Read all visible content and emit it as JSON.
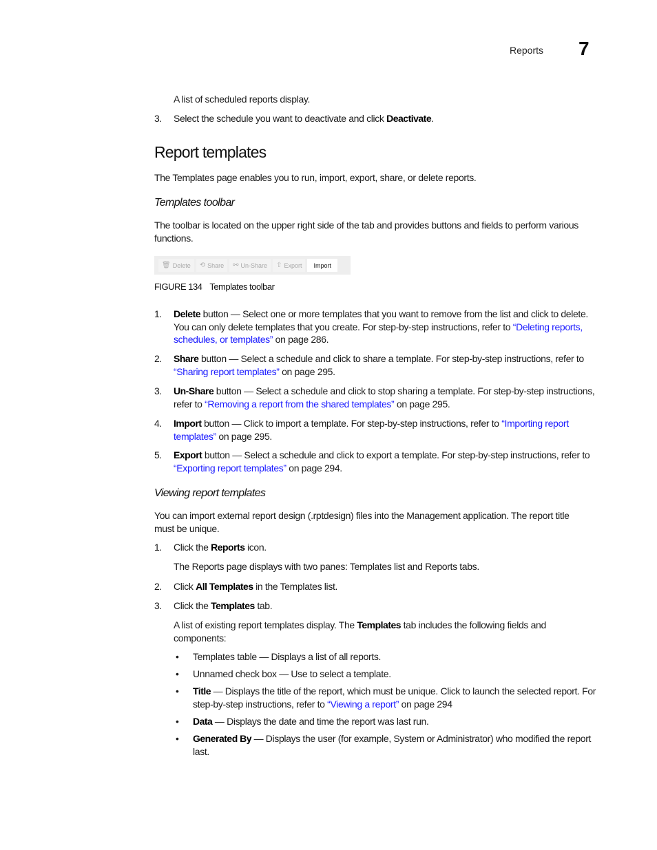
{
  "header": {
    "section": "Reports",
    "chapter_number": "7"
  },
  "intro": {
    "scheduled_list_text": "A list of scheduled reports display.",
    "step3_number": "3.",
    "step3_text_before": "Select the schedule you want to deactivate and click ",
    "step3_bold": "Deactivate",
    "step3_text_after": "."
  },
  "report_templates": {
    "title": "Report templates",
    "description": "The Templates page enables you to run, import, export, share, or delete reports."
  },
  "templates_toolbar": {
    "title": "Templates toolbar",
    "description": "The toolbar is located on the upper right side of the tab and provides buttons and fields to perform various functions.",
    "figure": {
      "buttons": [
        {
          "icon": "trash-icon",
          "glyph": "🗑",
          "label": "Delete",
          "enabled": false
        },
        {
          "icon": "share-icon",
          "glyph": "⟲",
          "label": "Share",
          "enabled": false
        },
        {
          "icon": "unshare-icon",
          "glyph": "⚯",
          "label": "Un-Share",
          "enabled": false
        },
        {
          "icon": "export-icon",
          "glyph": "⇧",
          "label": "Export",
          "enabled": false
        },
        {
          "icon": "",
          "glyph": "",
          "label": "Import",
          "enabled": true
        }
      ],
      "caption_label": "FIGURE 134",
      "caption_text": "Templates toolbar"
    },
    "items": [
      {
        "number": "1.",
        "bold": "Delete",
        "text": " button — Select one or more templates that you want to remove from the list and click to delete. You can only delete templates that you create. For step-by-step instructions, refer to ",
        "link": "“Deleting reports, schedules, or templates”",
        "after": " on page 286."
      },
      {
        "number": "2.",
        "bold": "Share",
        "text": " button — Select a schedule and click to share a template. For step-by-step instructions, refer to ",
        "link": "“Sharing report templates”",
        "after": " on page 295."
      },
      {
        "number": "3.",
        "bold": "Un-Share",
        "text": " button — Select a schedule and click to stop sharing a template. For step-by-step instructions, refer to ",
        "link": "“Removing a report from the shared templates”",
        "after": " on page 295."
      },
      {
        "number": "4.",
        "bold": "Import",
        "text": " button — Click to import a template. For step-by-step instructions, refer to ",
        "link": "“Importing report templates”",
        "after": " on page 295."
      },
      {
        "number": "5.",
        "bold": "Export",
        "text": " button — Select a schedule and click to export a template. For step-by-step instructions, refer to ",
        "link": "“Exporting report templates”",
        "after": " on page 294."
      }
    ]
  },
  "viewing": {
    "title": "Viewing report templates",
    "description": "You can import external report design (.rptdesign) files into the Management application. The report title must be unique.",
    "steps": [
      {
        "number": "1.",
        "before": "Click the ",
        "bold": "Reports",
        "after": " icon."
      },
      {
        "number": "2.",
        "before": "Click ",
        "bold": "All Templates",
        "after": " in the Templates list."
      },
      {
        "number": "3.",
        "before": "Click the ",
        "bold": "Templates",
        "after": " tab."
      }
    ],
    "step1_note": "The Reports page displays with two panes: Templates list and Reports tabs.",
    "step3_note_before": "A list of existing report templates display. The ",
    "step3_note_bold": "Templates",
    "step3_note_after": " tab includes the following fields and components:",
    "bullets": [
      {
        "bold": "",
        "text": "Templates table — Displays a list of all reports.",
        "link": "",
        "after": ""
      },
      {
        "bold": "",
        "text": "Unnamed check box — Use to select a template.",
        "link": "",
        "after": ""
      },
      {
        "bold": "Title",
        "text": " — Displays the title of the report, which must be unique. Click to launch the selected report. For step-by-step instructions, refer to ",
        "link": "“Viewing a report”",
        "after": " on page 294"
      },
      {
        "bold": "Data",
        "text": " — Displays the date and time the report was last run.",
        "link": "",
        "after": ""
      },
      {
        "bold": "Generated By",
        "text": " — Displays the user (for example, System or Administrator) who modified the report last.",
        "link": "",
        "after": ""
      }
    ],
    "bullet_glyph": "•"
  }
}
